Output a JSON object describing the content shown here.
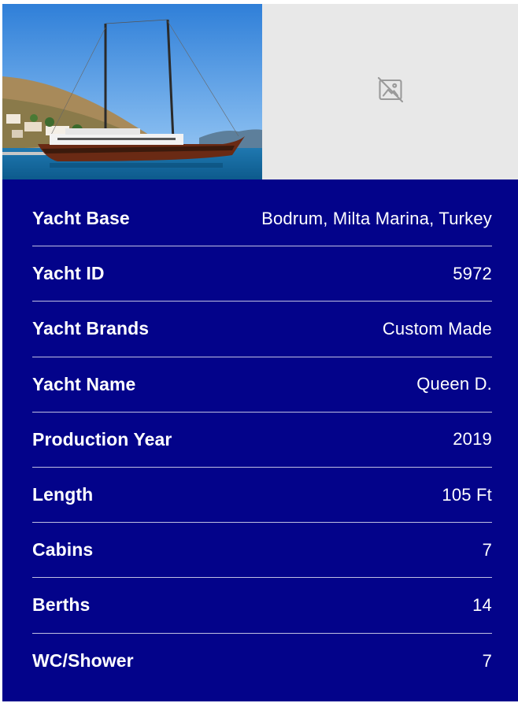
{
  "gallery": {
    "photo_alt": "Yacht photo",
    "placeholder_icon": "image-off-icon"
  },
  "colors": {
    "panel_bg": "#03038a",
    "text": "#ffffff",
    "placeholder_bg": "#e8e8e8"
  },
  "specs": [
    {
      "label": "Yacht Base",
      "value": "Bodrum, Milta Marina, Turkey"
    },
    {
      "label": "Yacht ID",
      "value": "5972"
    },
    {
      "label": "Yacht Brands",
      "value": "Custom Made"
    },
    {
      "label": "Yacht Name",
      "value": "Queen D."
    },
    {
      "label": "Production Year",
      "value": "2019"
    },
    {
      "label": "Length",
      "value": "105 Ft"
    },
    {
      "label": "Cabins",
      "value": "7"
    },
    {
      "label": "Berths",
      "value": "14"
    },
    {
      "label": "WC/Shower",
      "value": "7"
    }
  ]
}
